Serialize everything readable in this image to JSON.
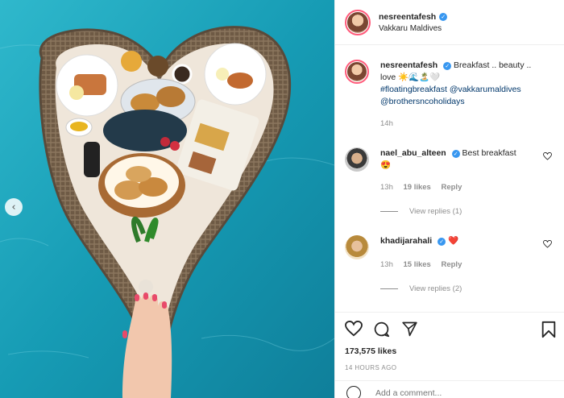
{
  "post": {
    "username": "nesreentafesh",
    "location": "Vakkaru Maldives"
  },
  "caption": {
    "username": "nesreentafesh",
    "text": "Breakfast .. beauty .. love ☀️🌊🏝️🤍",
    "hashtag": "#floatingbreakfast",
    "mention1": "@vakkarumaldives",
    "mention2": "@brothersncoholidays",
    "age": "14h"
  },
  "comments": [
    {
      "username": "nael_abu_alteen",
      "text": "Best breakfast",
      "emoji": "😍",
      "age": "13h",
      "likes": "19 likes",
      "reply": "Reply",
      "view_replies": "View replies (1)"
    },
    {
      "username": "khadijarahali",
      "text": "❤️",
      "age": "13h",
      "likes": "15 likes",
      "reply": "Reply",
      "view_replies": "View replies (2)"
    }
  ],
  "actions": {
    "like_count": "173,575 likes",
    "timestamp": "14 HOURS AGO",
    "add_comment_placeholder": "Add a comment..."
  },
  "icons": {
    "like": "heart-outline-icon",
    "comment": "speech-bubble-icon",
    "share": "paper-plane-icon",
    "save": "bookmark-icon",
    "verified": "verified-badge-icon",
    "prev": "chevron-left-icon"
  },
  "colors": {
    "verified": "#3897f0",
    "link": "#00376b",
    "secondary_text": "#8e8e8e",
    "water": "#1aa7bf"
  }
}
